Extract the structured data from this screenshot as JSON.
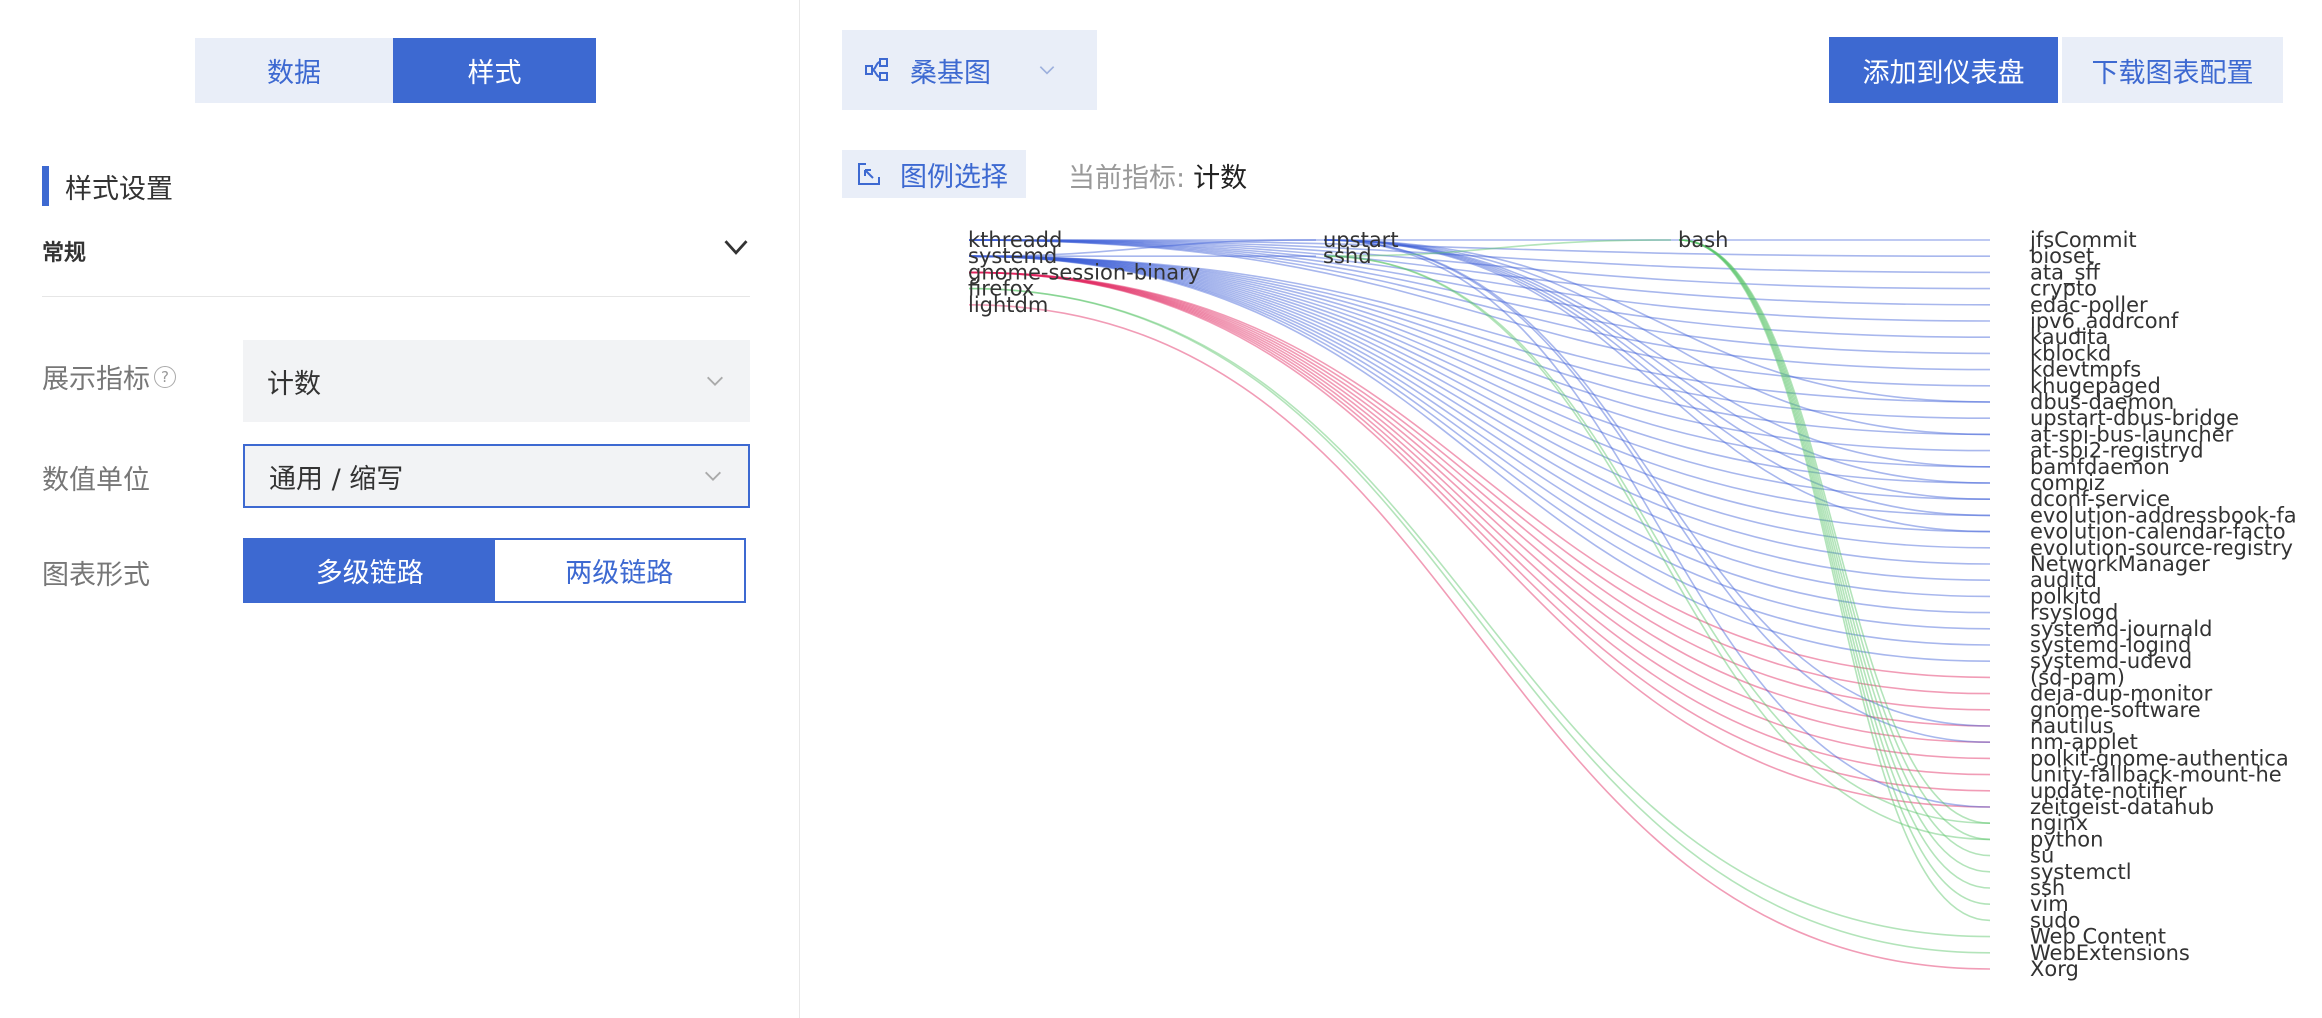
{
  "left_panel": {
    "tabs": [
      {
        "label": "数据",
        "active": false
      },
      {
        "label": "样式",
        "active": true
      }
    ],
    "section_title": "样式设置",
    "collapse": {
      "label": "常规",
      "icon": "chevron-down-icon"
    },
    "fields": {
      "metric": {
        "label": "展示指标",
        "value": "计数"
      },
      "unit": {
        "label": "数值单位",
        "value": "通用 / 缩写"
      },
      "form": {
        "label": "图表形式",
        "options": [
          "多级链路",
          "两级链路"
        ],
        "selected": "多级链路"
      }
    }
  },
  "toolbar": {
    "chart_type": "桑基图",
    "add_to_dashboard": "添加到仪表盘",
    "download_config": "下载图表配置",
    "legend_select": "图例选择",
    "current_metric_label": "当前指标:",
    "current_metric_value": "计数"
  },
  "colors": {
    "primary": "#3d69d1",
    "primary_light": "#e9eef8",
    "link_blue": "#3d5fd6",
    "link_red": "#e0245e",
    "link_green": "#56c465"
  },
  "chart_data": {
    "type": "sankey",
    "left_nodes": [
      "kthreadd",
      "systemd",
      "gnome-session-binary",
      "firefox",
      "lightdm"
    ],
    "middle_nodes": [
      "upstart",
      "sshd"
    ],
    "third_nodes": [
      "bash"
    ],
    "right_nodes": [
      "jfsCommit",
      "bioset",
      "ata_sff",
      "crypto",
      "edac-poller",
      "ipv6_addrconf",
      "kaudita",
      "kblockd",
      "kdevtmpfs",
      "khugepaged",
      "dbus-daemon",
      "upstart-dbus-bridge",
      "at-spi-bus-launcher",
      "at-spi2-registryd",
      "bamfdaemon",
      "compiz",
      "dconf-service",
      "evolution-addressbook-fa",
      "evolution-calendar-facto",
      "evolution-source-registry",
      "NetworkManager",
      "auditd",
      "polkitd",
      "rsyslogd",
      "systemd-journald",
      "systemd-logind",
      "systemd-udevd",
      "(sd-pam)",
      "deja-dup-monitor",
      "gnome-software",
      "nautilus",
      "nm-applet",
      "polkit-gnome-authentica",
      "unity-fallback-mount-he",
      "update-notifier",
      "zeitgeist-datahub",
      "nginx",
      "python",
      "su",
      "systemctl",
      "ssh",
      "vim",
      "sudo",
      "Web Content",
      "WebExtensions",
      "Xorg"
    ],
    "links": [
      {
        "source": "kthreadd",
        "targets": [
          "jfsCommit",
          "bioset",
          "ata_sff",
          "crypto",
          "edac-poller",
          "ipv6_addrconf",
          "kaudita",
          "kblockd",
          "kdevtmpfs",
          "khugepaged"
        ]
      },
      {
        "source": "systemd",
        "targets": [
          "upstart",
          "sshd",
          "dbus-daemon",
          "upstart-dbus-bridge",
          "at-spi-bus-launcher",
          "at-spi2-registryd",
          "bamfdaemon",
          "compiz",
          "dconf-service",
          "evolution-addressbook-fa",
          "evolution-calendar-facto",
          "evolution-source-registry",
          "NetworkManager",
          "auditd",
          "polkitd",
          "rsyslogd",
          "systemd-journald",
          "systemd-logind",
          "systemd-udevd"
        ]
      },
      {
        "source": "gnome-session-binary",
        "targets": [
          "(sd-pam)",
          "deja-dup-monitor",
          "gnome-software",
          "nautilus",
          "nm-applet",
          "polkit-gnome-authentica",
          "unity-fallback-mount-he",
          "update-notifier",
          "zeitgeist-datahub"
        ]
      },
      {
        "source": "firefox",
        "targets": [
          "Web Content",
          "WebExtensions"
        ]
      },
      {
        "source": "lightdm",
        "targets": [
          "Xorg"
        ]
      },
      {
        "source": "upstart",
        "targets": [
          "dbus-daemon",
          "at-spi-bus-launcher",
          "bamfdaemon",
          "compiz",
          "dconf-service",
          "evolution-addressbook-fa",
          "evolution-calendar-facto",
          "nautilus",
          "nm-applet",
          "zeitgeist-datahub"
        ]
      },
      {
        "source": "sshd",
        "targets": [
          "bash",
          "nginx",
          "python"
        ]
      },
      {
        "source": "bash",
        "targets": [
          "su",
          "systemctl",
          "ssh",
          "vim",
          "sudo",
          "nginx",
          "python"
        ]
      }
    ]
  }
}
